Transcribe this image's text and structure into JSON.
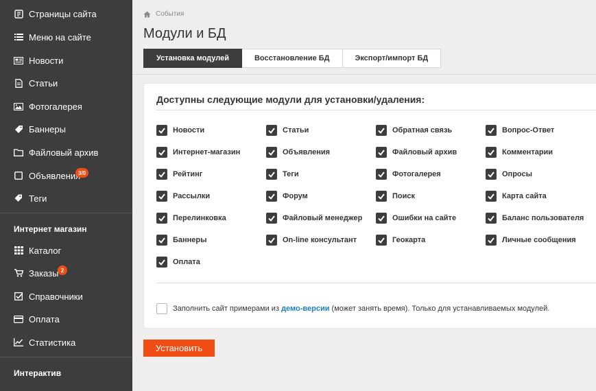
{
  "sidebar": {
    "items": [
      {
        "label": "Страницы сайта",
        "icon": "pages-icon"
      },
      {
        "label": "Меню на сайте",
        "icon": "menu-icon"
      },
      {
        "label": "Новости",
        "icon": "news-icon"
      },
      {
        "label": "Статьи",
        "icon": "article-icon"
      },
      {
        "label": "Фотогалерея",
        "icon": "photo-icon"
      },
      {
        "label": "Баннеры",
        "icon": "tag-icon"
      },
      {
        "label": "Файловый архив",
        "icon": "folder-icon"
      },
      {
        "label": "Объявления",
        "icon": "square-icon",
        "badge": "3/0"
      },
      {
        "label": "Теги",
        "icon": "tags-icon"
      }
    ],
    "shop_section": "Интернет магазин",
    "shop_items": [
      {
        "label": "Каталог",
        "icon": "catalog-icon"
      },
      {
        "label": "Заказы",
        "icon": "cart-icon",
        "badge": "2"
      },
      {
        "label": "Справочники",
        "icon": "checklist-icon"
      },
      {
        "label": "Оплата",
        "icon": "credit-card-icon"
      },
      {
        "label": "Статистика",
        "icon": "chart-icon"
      }
    ],
    "interactive_section": "Интерактив"
  },
  "breadcrumb": {
    "label": "События"
  },
  "page": {
    "title": "Модули и БД"
  },
  "tabs": [
    {
      "label": "Установка модулей",
      "active": true
    },
    {
      "label": "Восстановление БД",
      "active": false
    },
    {
      "label": "Экспорт/импорт БД",
      "active": false
    }
  ],
  "panel": {
    "title": "Доступны следующие модули для установки/удаления:",
    "modules": [
      [
        "Новости",
        "Статьи",
        "Обратная связь",
        "Вопрос-Ответ"
      ],
      [
        "Интернет-магазин",
        "Объявления",
        "Файловый архив",
        "Комментарии"
      ],
      [
        "Рейтинг",
        "Теги",
        "Фотогалерея",
        "Опросы"
      ],
      [
        "Рассылки",
        "Форум",
        "Поиск",
        "Карта сайта"
      ],
      [
        "Перелинковка",
        "Файловый менеджер",
        "Ошибки на сайте",
        "Баланс пользователя"
      ],
      [
        "Баннеры",
        "On-line консультант",
        "Геокарта",
        "Личные сообщения"
      ],
      [
        "Оплата"
      ]
    ],
    "demo": {
      "text_before": "Заполнить сайт примерами из ",
      "link": "демо-версии",
      "text_after": " (может занять время). Только для устанавливаемых модулей.",
      "checked": false
    }
  },
  "install_button": {
    "label": "Установить"
  },
  "colors": {
    "accent": "#f04e14",
    "sidebar": "#3d3d3d",
    "link": "#1a7fc6"
  }
}
